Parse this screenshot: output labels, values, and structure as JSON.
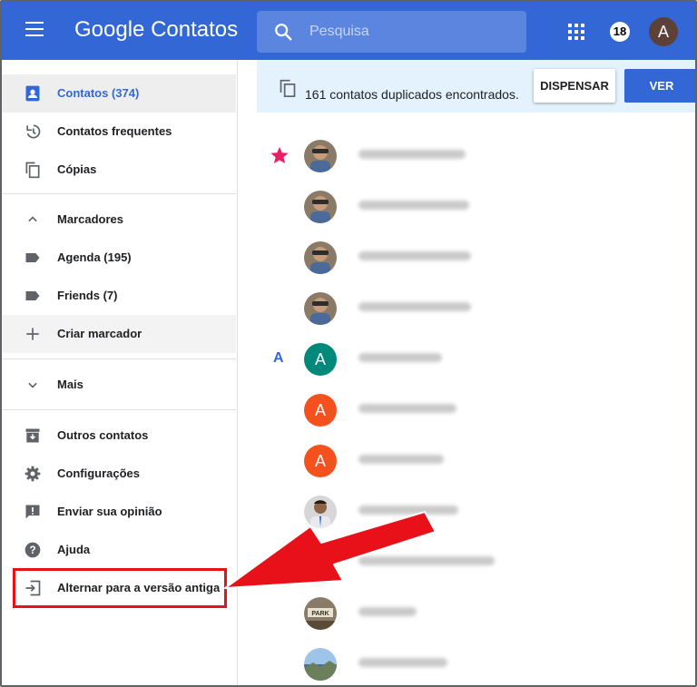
{
  "header": {
    "logo_google": "Google",
    "logo_app": "Contatos",
    "search_placeholder": "Pesquisa",
    "notification_count": "18",
    "avatar_letter": "A"
  },
  "sidebar": {
    "items": [
      {
        "label": "Contatos (374)",
        "icon": "contacts-icon"
      },
      {
        "label": "Contatos frequentes",
        "icon": "history-icon"
      },
      {
        "label": "Cópias",
        "icon": "copy-icon"
      },
      {
        "label": "Marcadores",
        "icon": "chevron-up-icon"
      },
      {
        "label": "Agenda (195)",
        "icon": "label-icon"
      },
      {
        "label": "Friends (7)",
        "icon": "label-icon"
      },
      {
        "label": "Criar marcador",
        "icon": "plus-icon"
      },
      {
        "label": "Mais",
        "icon": "chevron-down-icon"
      },
      {
        "label": "Outros contatos",
        "icon": "archive-icon"
      },
      {
        "label": "Configurações",
        "icon": "gear-icon"
      },
      {
        "label": "Enviar sua opinião",
        "icon": "feedback-icon"
      },
      {
        "label": "Ajuda",
        "icon": "help-icon"
      },
      {
        "label": "Alternar para a versão antiga",
        "icon": "exit-icon"
      }
    ]
  },
  "banner": {
    "message": "161 contatos duplicados encontrados.",
    "dismiss_label": "DISPENSAR",
    "view_label": "VER"
  },
  "contacts": {
    "section_letter": "A",
    "avatars": [
      {
        "type": "photo"
      },
      {
        "type": "photo"
      },
      {
        "type": "photo"
      },
      {
        "type": "photo"
      },
      {
        "type": "letter",
        "letter": "A",
        "color": "#00897b"
      },
      {
        "type": "letter",
        "letter": "A",
        "color": "#f4511e"
      },
      {
        "type": "letter",
        "letter": "A",
        "color": "#f4511e"
      },
      {
        "type": "photo"
      },
      {
        "type": "photo"
      },
      {
        "type": "photo"
      }
    ]
  },
  "colors": {
    "brand_blue": "#3367d6",
    "highlight_red": "#e8111a",
    "star_pink": "#e91e63"
  }
}
